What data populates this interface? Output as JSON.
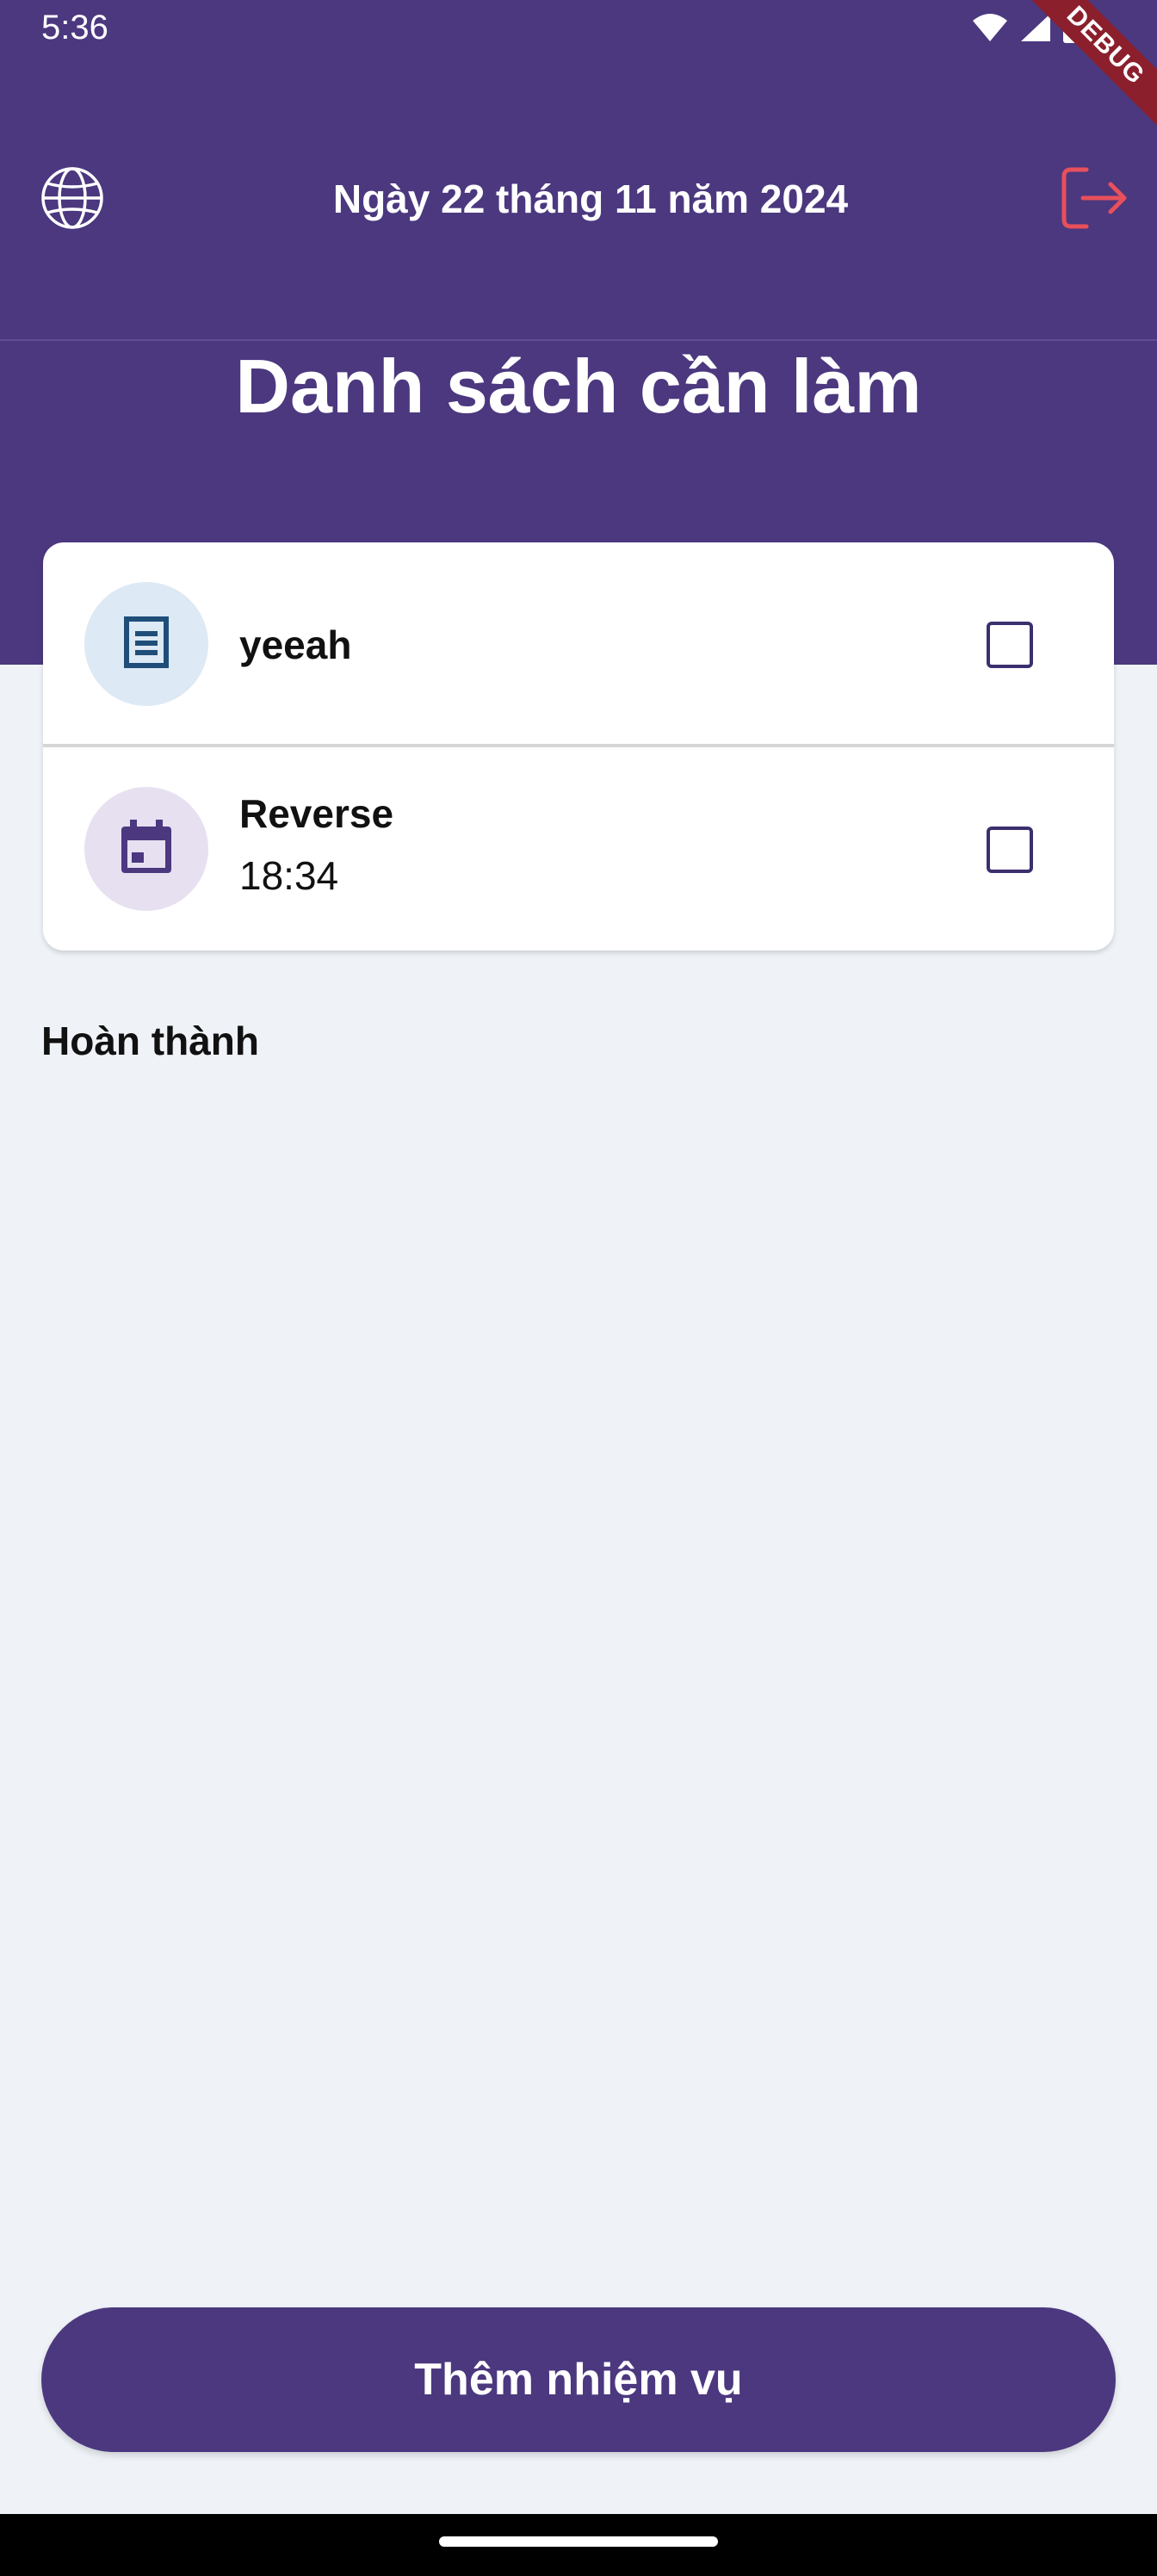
{
  "status_bar": {
    "time": "5:36",
    "icons": [
      "wifi-icon",
      "signal-icon",
      "battery-icon"
    ],
    "debug_label": "DEBUG"
  },
  "header": {
    "date": "Ngày 22 tháng 11 năm 2024",
    "title": "Danh sách cần làm",
    "left_icon": "globe-icon",
    "right_icon": "logout-icon"
  },
  "tasks": [
    {
      "title": "yeeah",
      "subtitle": "",
      "icon": "document-icon",
      "checked": false
    },
    {
      "title": "Reverse",
      "subtitle": "18:34",
      "icon": "calendar-icon",
      "checked": false
    }
  ],
  "completed_section": {
    "label": "Hoàn thành"
  },
  "actions": {
    "add_task_label": "Thêm nhiệm vụ"
  },
  "colors": {
    "primary": "#4b387f",
    "background": "#eff3f8",
    "logout_accent": "#e8505b",
    "document_avatar_bg": "#dde9f4",
    "calendar_avatar_bg": "#e6e0f1"
  }
}
